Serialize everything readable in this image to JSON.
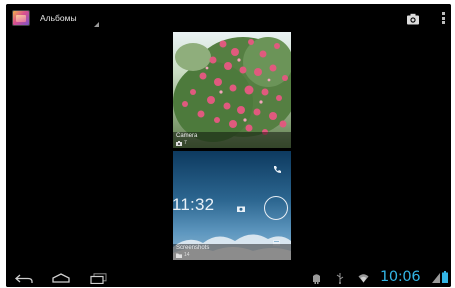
{
  "action_bar": {
    "title": "Альбомы"
  },
  "albums": [
    {
      "name": "Camera",
      "count": "7",
      "type_icon": "camera-icon"
    },
    {
      "name": "Screenshots",
      "count": "14",
      "type_icon": "folder-icon"
    }
  ],
  "screenshot_preview": {
    "clock": "11:32"
  },
  "status_bar": {
    "time": "10:06"
  },
  "colors": {
    "accent": "#33b5e5",
    "background": "#000000"
  },
  "icons": {
    "app": "gallery-app-icon",
    "camera": "camera-icon",
    "menu": "overflow-menu-icon",
    "back": "back-icon",
    "home": "home-icon",
    "recents": "recent-apps-icon",
    "android": "android-debug-icon",
    "usb": "usb-icon",
    "wifi": "wifi-icon",
    "signal": "signal-icon",
    "battery": "battery-icon"
  }
}
